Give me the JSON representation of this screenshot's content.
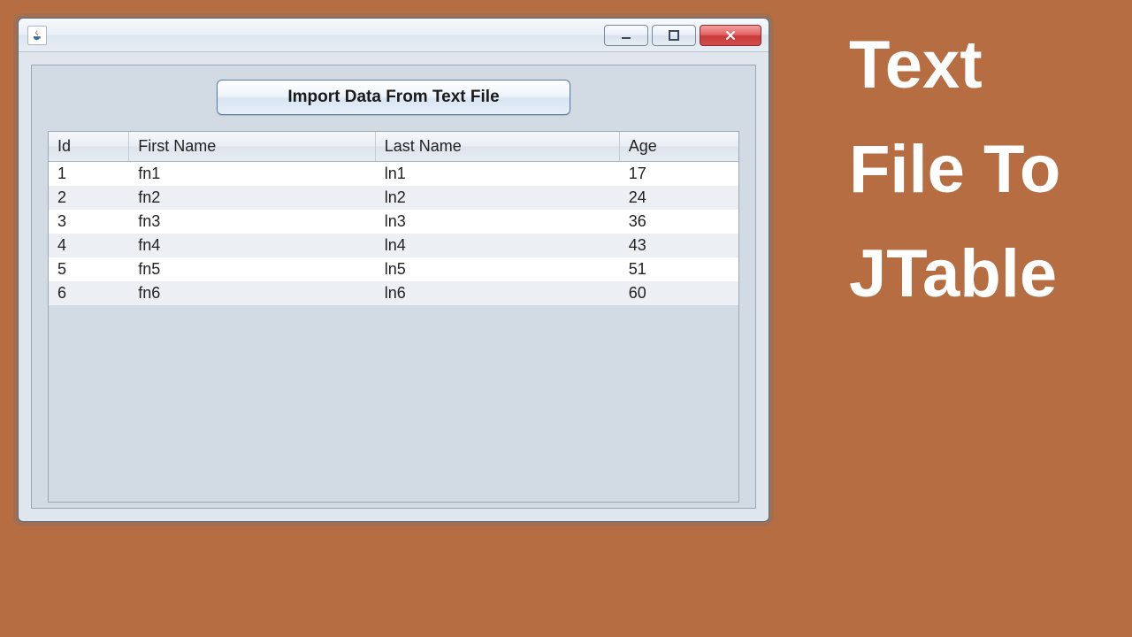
{
  "side": {
    "line1": "Text",
    "line2": "File To",
    "line3": "JTable"
  },
  "window": {
    "title": ""
  },
  "button": {
    "import_label": "Import Data From Text File"
  },
  "table": {
    "headers": {
      "id": "Id",
      "first": "First Name",
      "last": "Last Name",
      "age": "Age"
    },
    "rows": [
      {
        "id": "1",
        "first": "fn1",
        "last": "ln1",
        "age": "17"
      },
      {
        "id": "2",
        "first": "fn2",
        "last": "ln2",
        "age": "24"
      },
      {
        "id": "3",
        "first": "fn3",
        "last": "ln3",
        "age": "36"
      },
      {
        "id": "4",
        "first": "fn4",
        "last": "ln4",
        "age": "43"
      },
      {
        "id": "5",
        "first": "fn5",
        "last": "ln5",
        "age": "51"
      },
      {
        "id": "6",
        "first": "fn6",
        "last": "ln6",
        "age": "60"
      }
    ]
  }
}
